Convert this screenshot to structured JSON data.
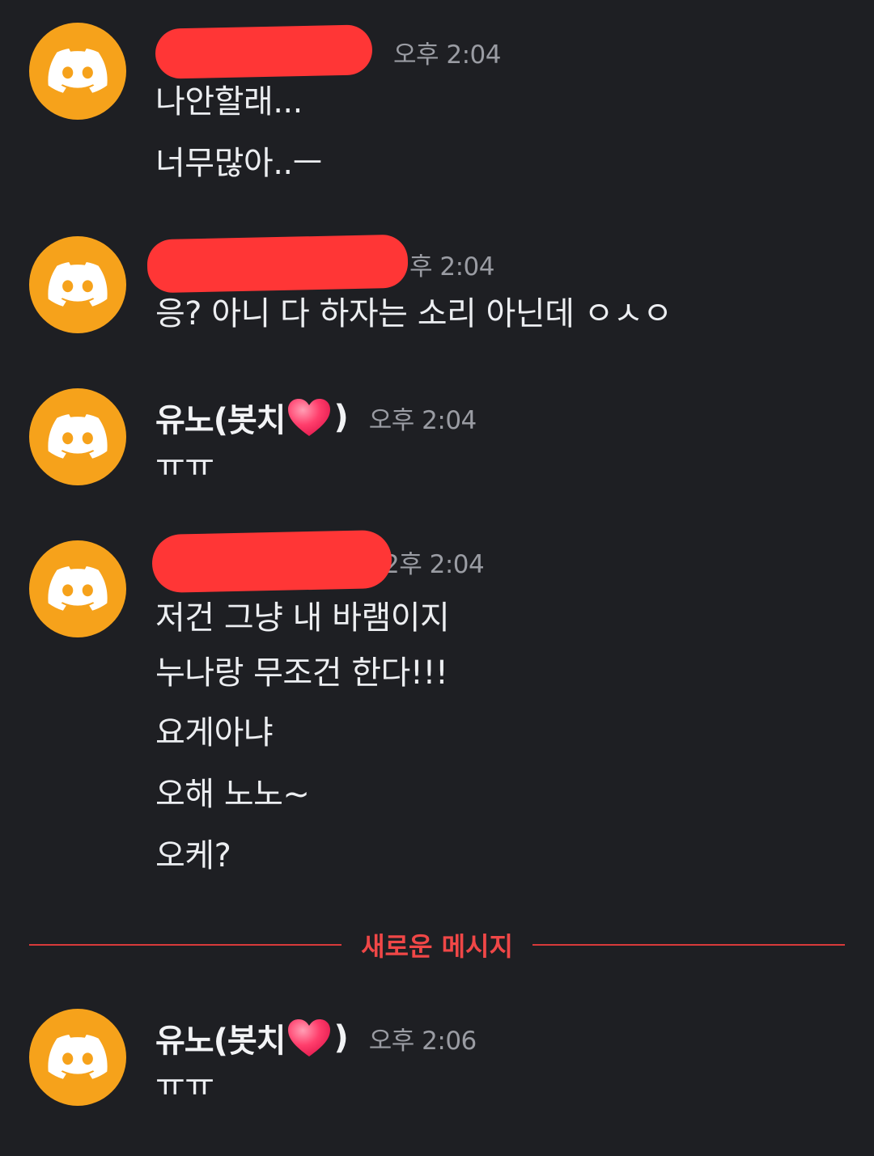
{
  "colors": {
    "background": "#1e1f23",
    "avatar": "#f6a21b",
    "redaction": "#ff3636",
    "new_message_divider": "#f04747",
    "timestamp": "#9a9ca3"
  },
  "avatar_icon": "discord-logo-icon",
  "groups": [
    {
      "username": "",
      "username_redacted": true,
      "timestamp": "오후 2:04",
      "messages": [
        "나안할래...",
        "너무많아..ㅡ"
      ]
    },
    {
      "username": "",
      "username_redacted": true,
      "timestamp": "후 2:04",
      "messages": [
        "응? 아니 다 하자는 소리 아닌데 ㅇㅅㅇ"
      ]
    },
    {
      "username": "유노(봇치",
      "username_suffix": ")",
      "username_emoji": "heart-emoji-icon",
      "timestamp": "오후 2:04",
      "messages": [
        "ㅠㅠ"
      ]
    },
    {
      "username": "",
      "username_redacted": true,
      "timestamp": "2후 2:04",
      "messages": [
        "저건 그냥 내 바램이지",
        "누나랑 무조건 한다!!!",
        "요게아냐",
        "오해 노노~",
        "오케?"
      ]
    }
  ],
  "divider": {
    "label": "새로운 메시지"
  },
  "new_groups": [
    {
      "username": "유노(봇치",
      "username_suffix": ")",
      "username_emoji": "heart-emoji-icon",
      "timestamp": "오후 2:06",
      "messages": [
        "ㅠㅠ"
      ]
    }
  ]
}
